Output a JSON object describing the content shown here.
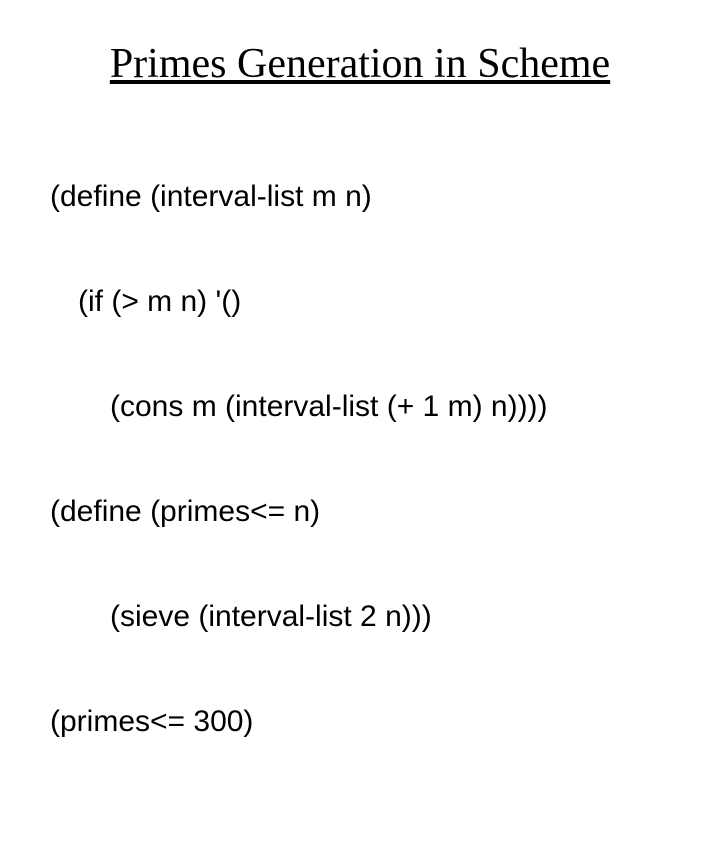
{
  "title": "Primes Generation in Scheme",
  "code": {
    "l1": "(define (interval-list m n)",
    "l2": "(if (> m n) '()",
    "l3": "(cons m (interval-list (+ 1 m) n))))",
    "l4": "(define (primes<= n)",
    "l5": "(sieve (interval-list 2 n)))",
    "l6": "(primes<= 300)"
  }
}
